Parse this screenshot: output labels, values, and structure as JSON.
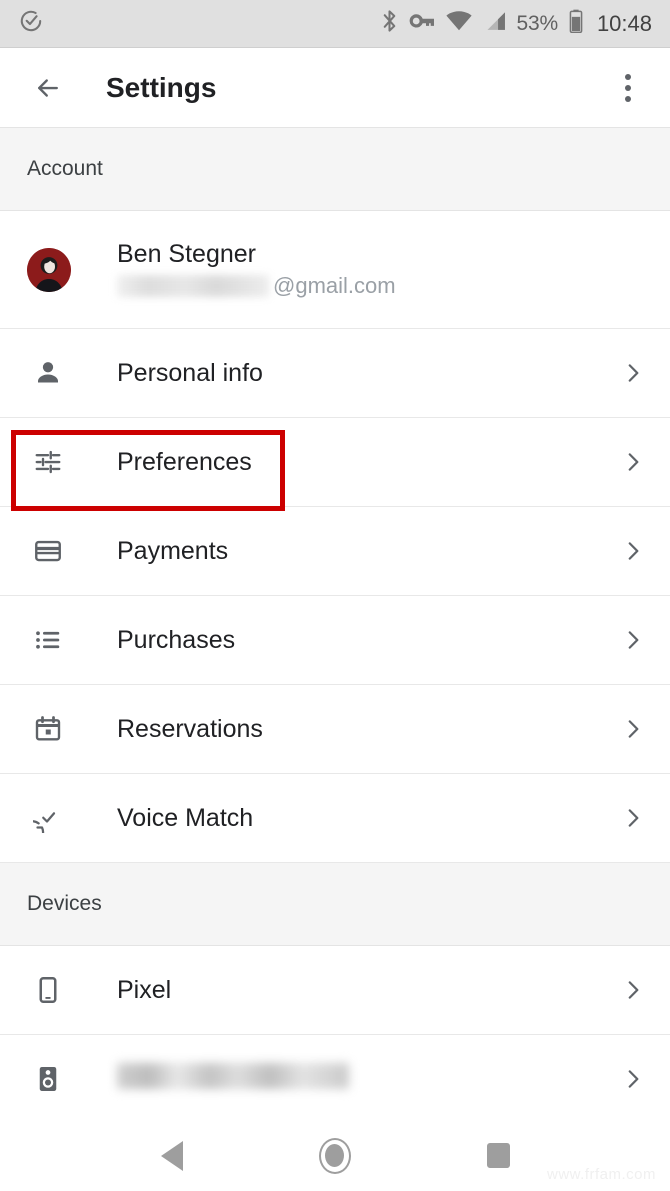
{
  "status_bar": {
    "left_icons": [
      {
        "name": "assistant-check-icon",
        "glyph": "assistant-check"
      }
    ],
    "right_icons": [
      {
        "name": "bluetooth-icon",
        "glyph": "bluetooth"
      },
      {
        "name": "vpn-key-icon",
        "glyph": "vpn-key"
      },
      {
        "name": "wifi-icon",
        "glyph": "wifi"
      },
      {
        "name": "cellular-signal-icon",
        "glyph": "cellular"
      },
      {
        "name": "battery-icon",
        "glyph": "battery"
      }
    ],
    "battery_percent": "53%",
    "clock": "10:48"
  },
  "app_bar": {
    "back_label": "Back",
    "title": "Settings",
    "overflow_label": "More options"
  },
  "sections": [
    {
      "header": "Account",
      "rows": [
        {
          "type": "account",
          "icon": "avatar",
          "name": "Ben Stegner",
          "email_redacted": true,
          "email_suffix": "@gmail.com"
        },
        {
          "type": "nav",
          "icon": "person-icon",
          "label": "Personal info",
          "chevron": true
        },
        {
          "type": "nav",
          "icon": "tune-icon",
          "label": "Preferences",
          "chevron": true,
          "highlighted": true
        },
        {
          "type": "nav",
          "icon": "credit-card-icon",
          "label": "Payments",
          "chevron": true
        },
        {
          "type": "nav",
          "icon": "list-icon",
          "label": "Purchases",
          "chevron": true
        },
        {
          "type": "nav",
          "icon": "calendar-icon",
          "label": "Reservations",
          "chevron": true
        },
        {
          "type": "nav",
          "icon": "voice-match-icon",
          "label": "Voice Match",
          "chevron": true
        }
      ]
    },
    {
      "header": "Devices",
      "rows": [
        {
          "type": "nav",
          "icon": "phone-icon",
          "label": "Pixel",
          "chevron": true
        },
        {
          "type": "redacted",
          "icon": "speaker-icon",
          "label": "",
          "chevron": true
        }
      ]
    }
  ],
  "annotation": {
    "color": "#cc0000",
    "target": "Preferences"
  },
  "nav_bar": {
    "back_label": "Back",
    "home_label": "Home",
    "recents_label": "Recents"
  },
  "watermark": "www.frfam.com"
}
